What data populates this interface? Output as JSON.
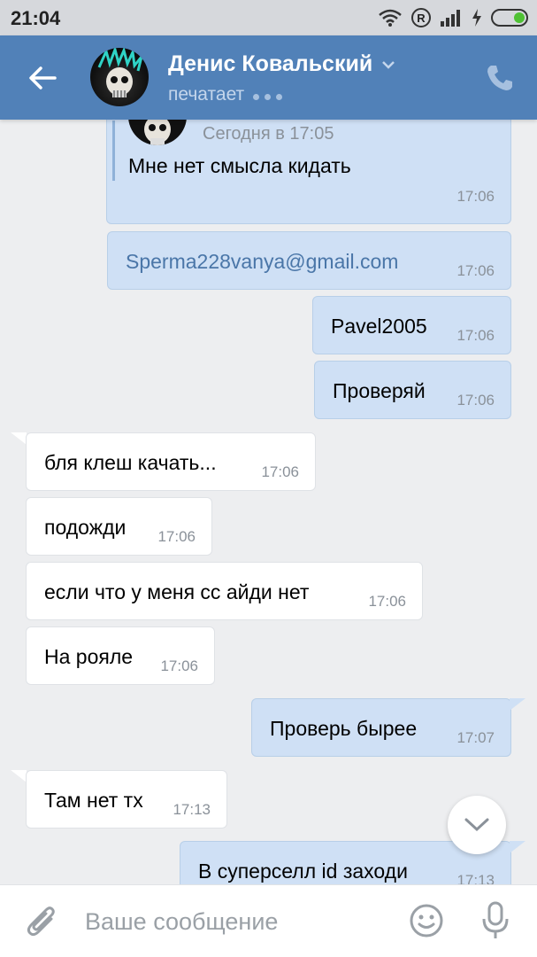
{
  "status_bar": {
    "time": "21:04",
    "r_badge": "R",
    "icons": [
      "wifi-icon",
      "signal-icon",
      "charging-icon",
      "battery-icon"
    ]
  },
  "header": {
    "name": "Денис Ковальский",
    "status": "печатает",
    "icons": [
      "back-arrow-icon",
      "chevron-down-icon",
      "phone-icon"
    ],
    "colors": {
      "bar": "#5181b8",
      "status_text": "#c4d6ec"
    }
  },
  "forwarded": {
    "date": "Сегодня в 17:05",
    "text": "Мне нет смысла кидать",
    "time": "17:06"
  },
  "messages": [
    {
      "dir": "out",
      "text": "Sperma228vanya@gmail.com",
      "time": "17:06",
      "link": true
    },
    {
      "dir": "out",
      "text": "Pavel2005",
      "time": "17:06"
    },
    {
      "dir": "out",
      "text": "Проверяй",
      "time": "17:06"
    },
    {
      "dir": "in",
      "text": "бля клеш качать...",
      "time": "17:06"
    },
    {
      "dir": "in",
      "text": "подожди",
      "time": "17:06"
    },
    {
      "dir": "in",
      "text": "если что у меня сс айди нет",
      "time": "17:06"
    },
    {
      "dir": "in",
      "text": "На рояле",
      "time": "17:06"
    },
    {
      "dir": "out",
      "text": "Проверь бырее",
      "time": "17:07"
    },
    {
      "dir": "in",
      "text": "Там нет тх",
      "time": "17:13"
    },
    {
      "dir": "out",
      "text": "В суперселл id заходи",
      "time": "17:13"
    }
  ],
  "colors": {
    "outgoing_bubble": "#cfe0f5",
    "incoming_bubble": "#ffffff",
    "background": "#edeef0",
    "link": "#4a76a8"
  },
  "input": {
    "placeholder": "Ваше сообщение"
  },
  "input_icons": [
    "attach-icon",
    "emoji-icon",
    "mic-icon"
  ],
  "scroll_icon": "chevron-down-icon"
}
